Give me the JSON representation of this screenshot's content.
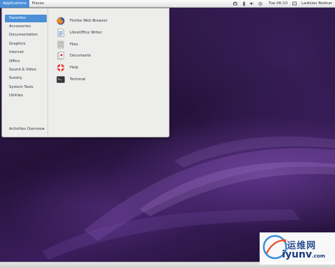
{
  "topbar": {
    "applications_label": "Applications",
    "places_label": "Places",
    "clock": "Tue 06:10",
    "user": "Ladislav Bodnar"
  },
  "app_menu": {
    "categories": [
      {
        "label": "Favorites",
        "selected": true
      },
      {
        "label": "Accessories"
      },
      {
        "label": "Documentation"
      },
      {
        "label": "Graphics"
      },
      {
        "label": "Internet"
      },
      {
        "label": "Office"
      },
      {
        "label": "Sound & Video"
      },
      {
        "label": "Sundry"
      },
      {
        "label": "System Tools"
      },
      {
        "label": "Utilities"
      }
    ],
    "activities_label": "Activities Overview",
    "apps": [
      {
        "label": "Firefox Web Browser",
        "icon": "firefox-icon"
      },
      {
        "label": "LibreOffice Writer",
        "icon": "writer-icon"
      },
      {
        "label": "Files",
        "icon": "files-icon"
      },
      {
        "label": "Documents",
        "icon": "documents-icon"
      },
      {
        "label": "Help",
        "icon": "help-icon"
      },
      {
        "label": "Terminal",
        "icon": "terminal-icon"
      }
    ]
  },
  "watermark": {
    "text_cn": "运维网",
    "url_main": "iyunv",
    "url_tld": ".com"
  },
  "colors": {
    "accent": "#4a90d9",
    "desktop": "#2a1640",
    "menu_bg": "#ededec"
  }
}
